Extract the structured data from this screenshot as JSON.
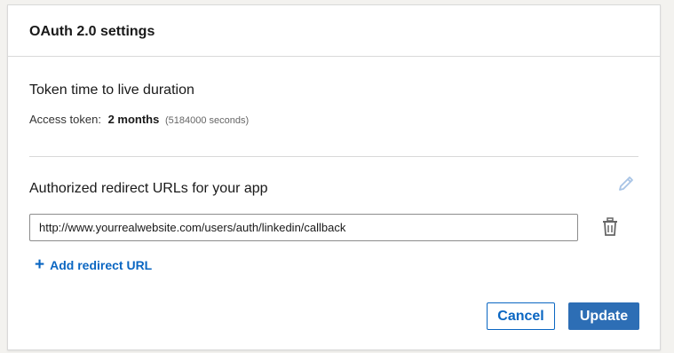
{
  "card": {
    "title": "OAuth 2.0 settings"
  },
  "token": {
    "section_title": "Token time to live duration",
    "label": "Access token:",
    "value": "2 months",
    "detail": "(5184000 seconds)"
  },
  "redirects": {
    "section_title": "Authorized redirect URLs for your app",
    "urls": [
      "http://www.yourrealwebsite.com/users/auth/linkedin/callback"
    ],
    "add_label": "Add redirect URL",
    "edit_icon": "pencil-icon",
    "delete_icon": "trash-icon"
  },
  "actions": {
    "cancel_label": "Cancel",
    "update_label": "Update"
  },
  "colors": {
    "accent": "#0a66c2",
    "primary_button": "#2d6eb5",
    "edit_icon": "#a8c4e6"
  }
}
